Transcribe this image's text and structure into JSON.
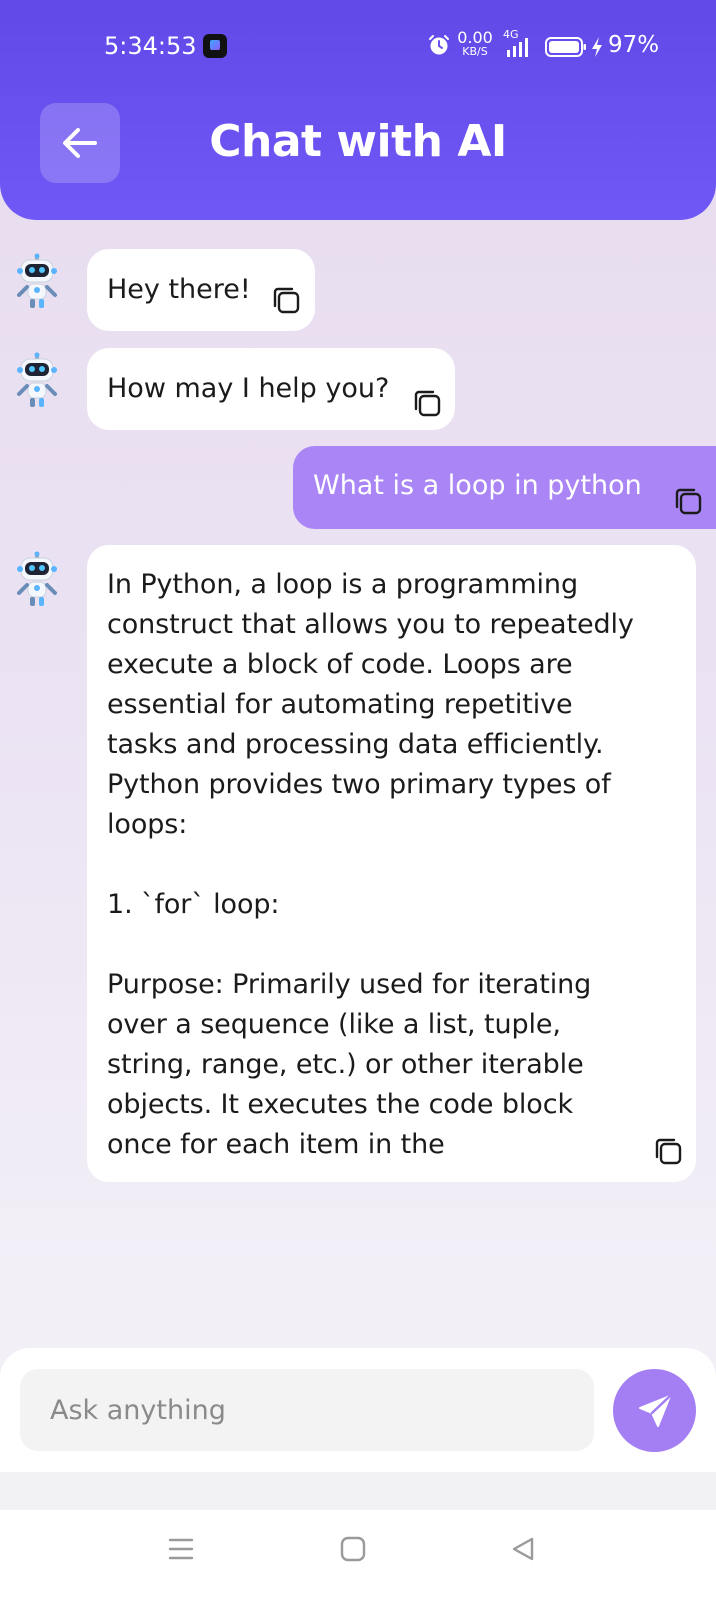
{
  "status_bar": {
    "time": "5:34:53",
    "net_speed_value": "0.00",
    "net_speed_unit": "KB/S",
    "network_type": "4G",
    "battery": "97%"
  },
  "header": {
    "title": "Chat with AI"
  },
  "messages": [
    {
      "sender": "bot",
      "text": "Hey there!"
    },
    {
      "sender": "bot",
      "text": "How may I help you?"
    },
    {
      "sender": "user",
      "text": "What is a loop in python"
    },
    {
      "sender": "bot",
      "text": "In Python, a loop is a programming construct that allows you to repeatedly execute a block of code. Loops are essential for automating repetitive tasks and processing data efficiently. Python provides two primary types of loops:\n\n1. `for` loop:\n\n   Purpose: Primarily used for iterating over a sequence (like a list, tuple, string, range, etc.) or other iterable objects. It executes the code block once for each item in the"
    }
  ],
  "input": {
    "placeholder": "Ask anything",
    "value": ""
  },
  "colors": {
    "header": "#6a52f2",
    "user_bubble": "#a985f5",
    "send_button": "#a47ef3"
  },
  "icons": {
    "back": "arrow-left-icon",
    "copy": "copy-icon",
    "send": "paper-plane-icon",
    "avatar": "robot-icon"
  }
}
